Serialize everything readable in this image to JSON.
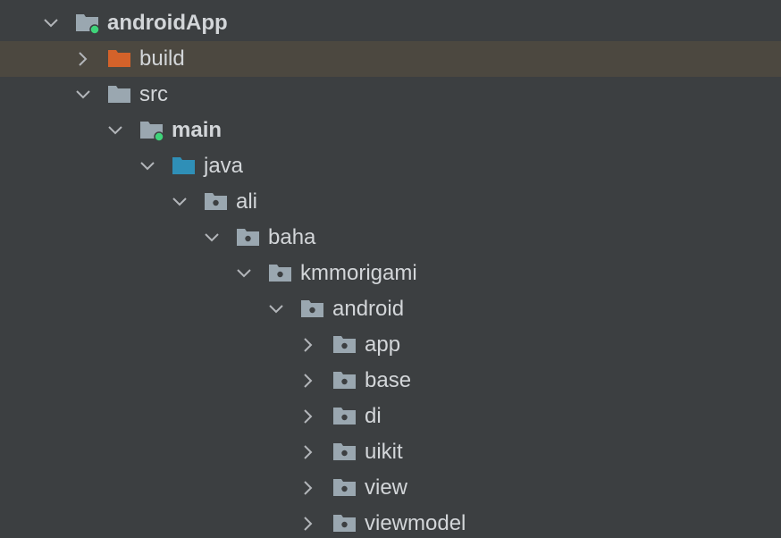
{
  "project_tree": {
    "nodes": [
      {
        "name": "tree-node-androidApp",
        "label": "androidApp",
        "expanded": true,
        "icon": "module-folder-icon",
        "bold": true
      },
      {
        "name": "tree-node-build",
        "label": "build",
        "expanded": false,
        "icon": "excluded-folder-icon",
        "selected": true
      },
      {
        "name": "tree-node-src",
        "label": "src",
        "expanded": true,
        "icon": "folder-icon"
      },
      {
        "name": "tree-node-main",
        "label": "main",
        "expanded": true,
        "icon": "module-folder-icon",
        "bold": true
      },
      {
        "name": "tree-node-java",
        "label": "java",
        "expanded": true,
        "icon": "source-root-icon"
      },
      {
        "name": "tree-node-ali",
        "label": "ali",
        "expanded": true,
        "icon": "package-icon"
      },
      {
        "name": "tree-node-baha",
        "label": "baha",
        "expanded": true,
        "icon": "package-icon"
      },
      {
        "name": "tree-node-kmmorigami",
        "label": "kmmorigami",
        "expanded": true,
        "icon": "package-icon"
      },
      {
        "name": "tree-node-android",
        "label": "android",
        "expanded": true,
        "icon": "package-icon"
      },
      {
        "name": "tree-node-app",
        "label": "app",
        "expanded": false,
        "icon": "package-icon"
      },
      {
        "name": "tree-node-base",
        "label": "base",
        "expanded": false,
        "icon": "package-icon"
      },
      {
        "name": "tree-node-di",
        "label": "di",
        "expanded": false,
        "icon": "package-icon"
      },
      {
        "name": "tree-node-uikit",
        "label": "uikit",
        "expanded": false,
        "icon": "package-icon"
      },
      {
        "name": "tree-node-view",
        "label": "view",
        "expanded": false,
        "icon": "package-icon"
      },
      {
        "name": "tree-node-viewmodel",
        "label": "viewmodel",
        "expanded": false,
        "icon": "package-icon"
      }
    ]
  },
  "colors": {
    "background": "#3c3f41",
    "selected_row": "#4c4840",
    "text": "#d3d6d9",
    "folder": "#9aa7b0",
    "excluded_folder": "#d4622a",
    "source_root_folder": "#2f8fb7",
    "module_dot": "#3fd47a",
    "chevron": "#b3b6ba"
  }
}
